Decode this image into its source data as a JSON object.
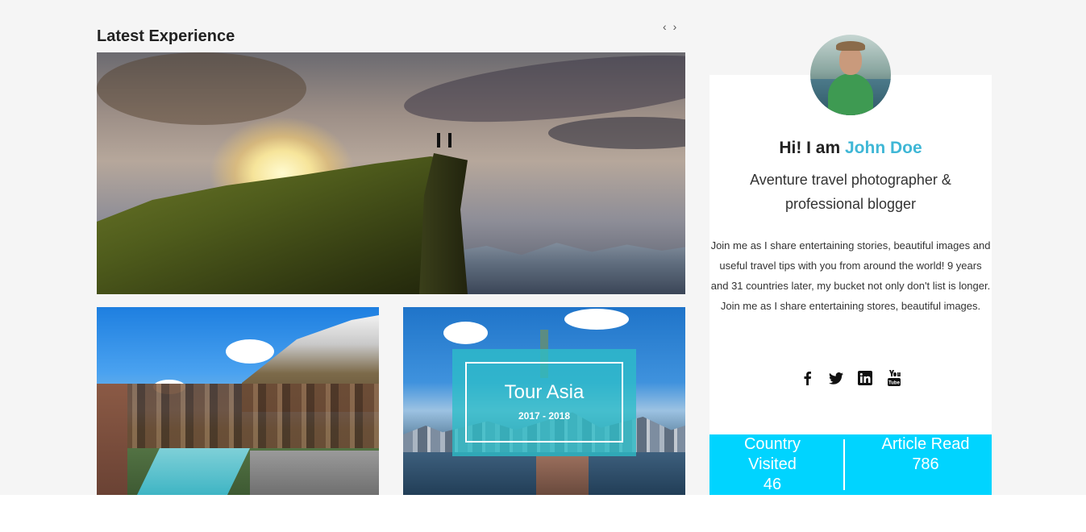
{
  "section": {
    "title": "Latest Experience"
  },
  "carousel": {
    "prev": "‹",
    "next": "›"
  },
  "tour": {
    "title": "Tour Asia",
    "years": "2017 - 2018"
  },
  "profile": {
    "greeting_prefix": "Hi! I am ",
    "name": "John Doe",
    "tagline": "Aventure travel photographer & professional blogger",
    "bio": "Join me as I share entertaining stories, beautiful images and useful travel tips with you from around the world! 9 years and 31 countries later, my bucket not only don't list is longer. Join me as I share entertaining stores, beautiful images."
  },
  "social": [
    {
      "icon": "facebook-icon"
    },
    {
      "icon": "twitter-icon"
    },
    {
      "icon": "linkedin-icon"
    },
    {
      "icon": "youtube-icon"
    }
  ],
  "stats": {
    "country_label": "Country Visited",
    "country_value": "46",
    "article_label": "Article Read",
    "article_value": "786"
  },
  "colors": {
    "accent": "#3fb7d6",
    "stats_bg": "#00d4ff",
    "tour_overlay": "#2dbec8"
  }
}
